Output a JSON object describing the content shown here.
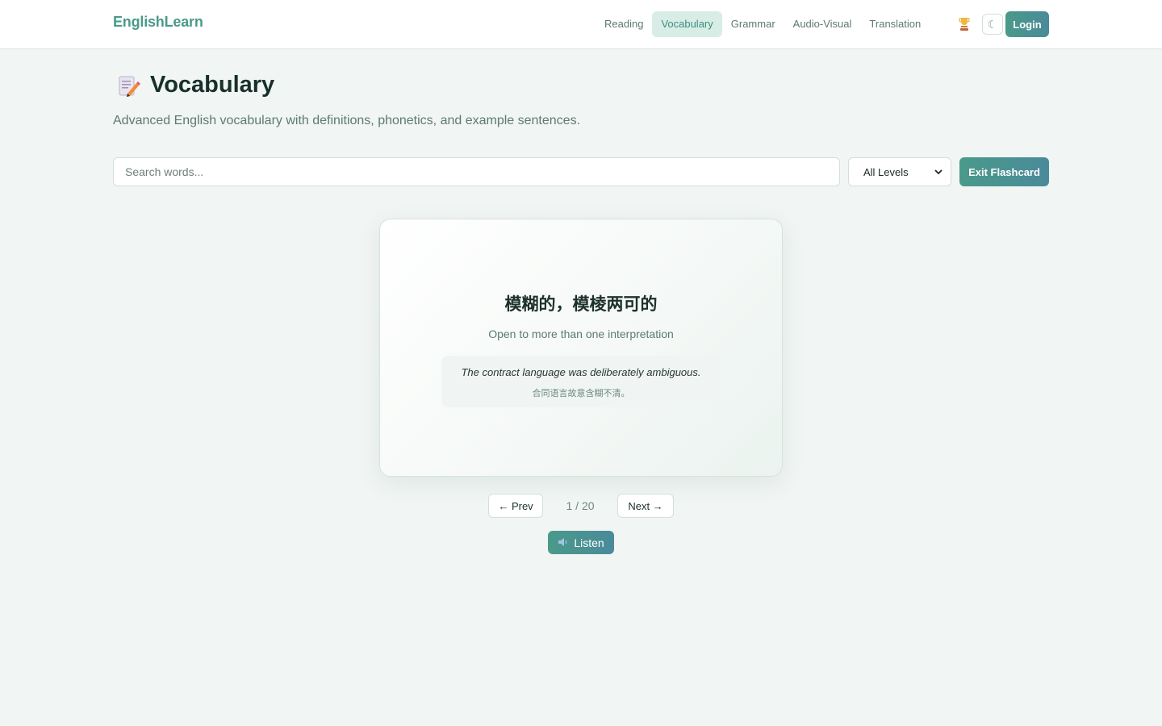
{
  "navbar": {
    "brand": "EnglishLearn",
    "links": [
      {
        "label": "Reading",
        "active": false
      },
      {
        "label": "Vocabulary",
        "active": true
      },
      {
        "label": "Grammar",
        "active": false
      },
      {
        "label": "Audio-Visual",
        "active": false
      },
      {
        "label": "Translation",
        "active": false
      }
    ],
    "trophy_icon": "trophy-icon",
    "theme_toggle_glyph": "☾",
    "login_label": "Login"
  },
  "header": {
    "icon": "memo-icon",
    "title": "Vocabulary",
    "subtitle": "Advanced English vocabulary with definitions, phonetics, and example sentences."
  },
  "controls": {
    "search_placeholder": "Search words...",
    "search_value": "",
    "level_selected": "All Levels",
    "exit_label": "Exit Flashcard"
  },
  "flashcard": {
    "word_zh": "模糊的，模棱两可的",
    "definition": "Open to more than one interpretation",
    "example_en": "The contract language was deliberately ambiguous.",
    "example_zh": "合同语言故意含糊不清。"
  },
  "pagination": {
    "prev_label": "← Prev",
    "counter": "1 / 20",
    "next_label": "Next →"
  },
  "listen": {
    "icon": "speaker-icon",
    "label": "Listen"
  },
  "colors": {
    "accent": "#4a9a8a",
    "background": "#f1f5f3",
    "nav_active_bg": "#d8ede6"
  }
}
